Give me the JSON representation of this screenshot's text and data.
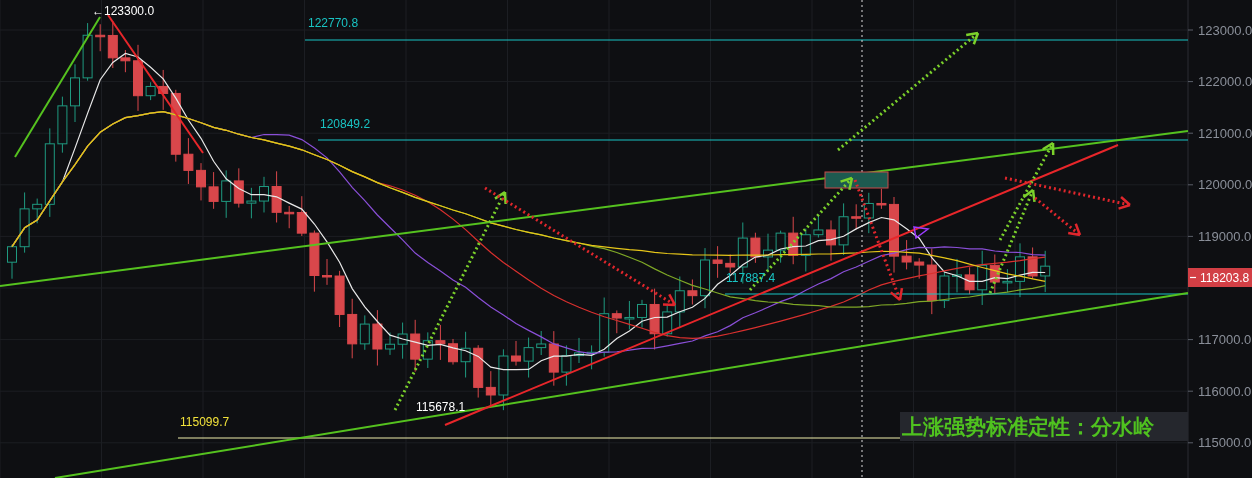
{
  "chart": {
    "price_axis": {
      "ticks": [
        "123000.0",
        "122000.0",
        "121000.0",
        "120000.0",
        "119000.0",
        "117000.0",
        "116000.0",
        "115000.0"
      ]
    },
    "current_price": {
      "label": "118203.8"
    },
    "price_labels": [
      {
        "text": "←123300.0",
        "kind": "extreme"
      },
      {
        "text": "122770.8",
        "kind": "level"
      },
      {
        "text": "120849.2",
        "kind": "level"
      },
      {
        "text": "117887.4",
        "kind": "level"
      },
      {
        "text": "115678.1",
        "kind": "extreme"
      },
      {
        "text": "115099.7",
        "kind": "support"
      }
    ],
    "annotation": "上涨强势标准定性：分水岭"
  }
}
